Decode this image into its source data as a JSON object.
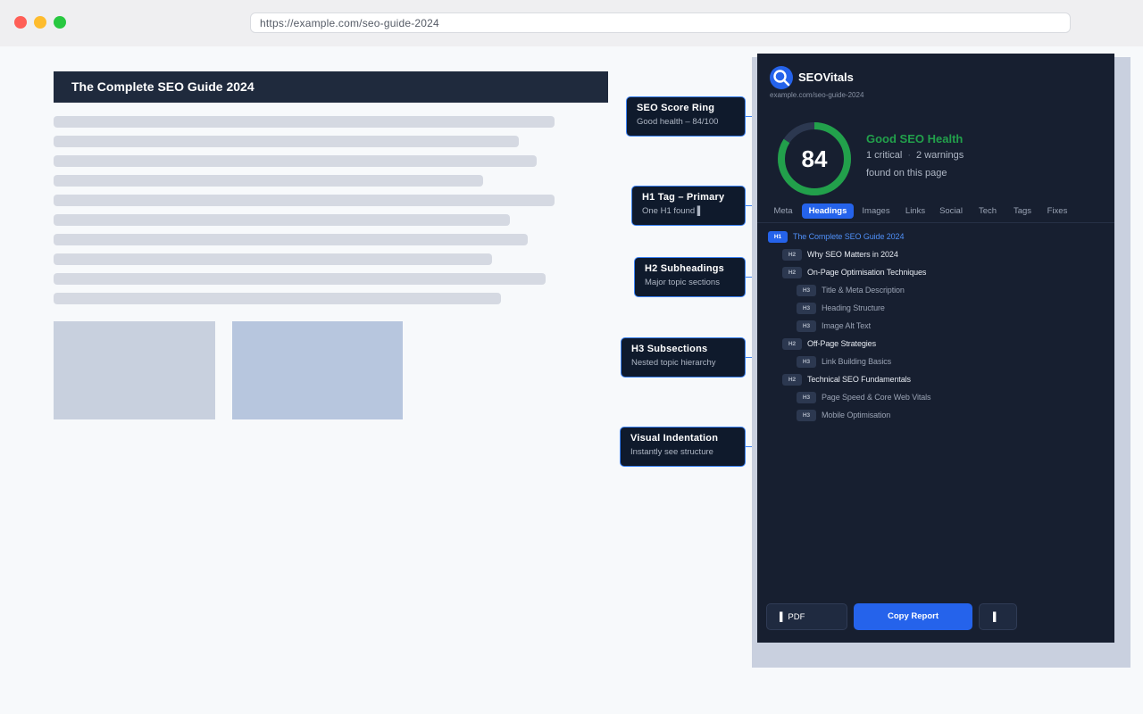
{
  "browser": {
    "url": "https://example.com/seo-guide-2024"
  },
  "page": {
    "title": "The Complete SEO Guide 2024"
  },
  "callouts": [
    {
      "title": "SEO Score Ring",
      "subtitle": "Good health – 84/100"
    },
    {
      "title": "H1 Tag – Primary",
      "subtitle": "One H1 found ▌"
    },
    {
      "title": "H2 Subheadings",
      "subtitle": "Major topic sections"
    },
    {
      "title": "H3 Subsections",
      "subtitle": "Nested topic hierarchy"
    },
    {
      "title": "Visual Indentation",
      "subtitle": "Instantly see structure"
    }
  ],
  "panel": {
    "brand": "SEOVitals",
    "url": "example.com/seo-guide-2024",
    "score": "84",
    "score_fraction": 0.84,
    "health_label": "Good SEO Health",
    "critical": "1 critical",
    "warnings": "2 warnings",
    "found": "found on this page",
    "separator": "·",
    "tabs": [
      "Meta",
      "Headings",
      "Images",
      "Links",
      "Social",
      "Tech",
      "Tags",
      "Fixes"
    ],
    "active_tab": "Headings",
    "headings": [
      {
        "level": "H1",
        "text": "The Complete SEO Guide 2024"
      },
      {
        "level": "H2",
        "text": "Why SEO Matters in 2024"
      },
      {
        "level": "H2",
        "text": "On-Page Optimisation Techniques"
      },
      {
        "level": "H3",
        "text": "Title & Meta Description"
      },
      {
        "level": "H3",
        "text": "Heading Structure"
      },
      {
        "level": "H3",
        "text": "Image Alt Text"
      },
      {
        "level": "H2",
        "text": "Off-Page Strategies"
      },
      {
        "level": "H3",
        "text": "Link Building Basics"
      },
      {
        "level": "H2",
        "text": "Technical SEO Fundamentals"
      },
      {
        "level": "H3",
        "text": "Page Speed & Core Web Vitals"
      },
      {
        "level": "H3",
        "text": "Mobile Optimisation"
      }
    ],
    "buttons": {
      "pdf": "▌ PDF",
      "copy": "Copy Report",
      "more": "▌"
    }
  },
  "colors": {
    "accent": "#2563eb",
    "good": "#22a04b",
    "panel_bg": "#171f30"
  }
}
